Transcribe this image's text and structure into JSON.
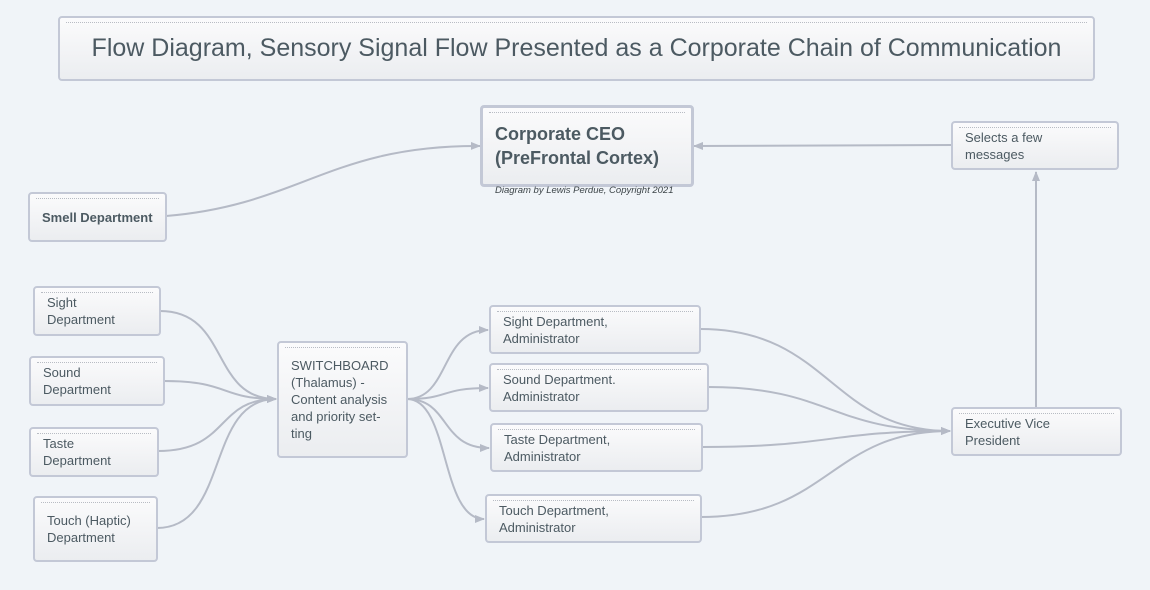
{
  "title": "Flow Diagram, Sensory Signal Flow Presented as a Corporate Chain of Communication",
  "ceo": {
    "label": "Corporate CEO (PreFrontal Cortex)",
    "caption": "Diagram by Lewis Perdue, Copyright 2021"
  },
  "selects": {
    "label": "Selects a few messages"
  },
  "smell": {
    "label": "Smell Department"
  },
  "departments": [
    {
      "label": "Sight Department"
    },
    {
      "label": "Sound Department"
    },
    {
      "label": "Taste Department"
    },
    {
      "label": "Touch (Haptic) Department"
    }
  ],
  "switchboard": {
    "label": "SWITCHBOARD (Thalamus) - Content analysis and priority set-ting"
  },
  "administrators": [
    {
      "label": "Sight Department, Administrator"
    },
    {
      "label": "Sound Department. Administrator"
    },
    {
      "label": "Taste Department, Administrator"
    },
    {
      "label": "Touch Department, Administrator"
    }
  ],
  "evp": {
    "label": "Executive Vice President"
  },
  "colors": {
    "edge": "#b5bac6",
    "node_border": "#c3c8d6",
    "text": "#4c5a62",
    "background": "#f0f4f8"
  }
}
